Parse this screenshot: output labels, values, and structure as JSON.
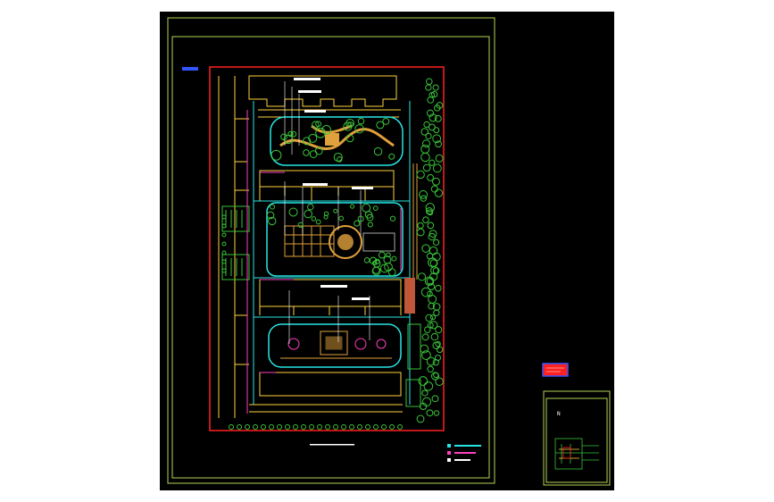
{
  "viewer": {
    "background": "#ffffff",
    "canvas_color": "#000000"
  },
  "drawing": {
    "frame_color": "#b4d455",
    "boundary_color": "#ff2020",
    "building_color": "#ffd23c",
    "road_color": "#27e6e6",
    "path_color": "#ff3fbf",
    "tree_color": "#39c43a",
    "paving_color": "#e0a13c",
    "label_color": "#ffffff",
    "tag_color": "#3355ff"
  },
  "legend": {
    "items": [
      {
        "swatch": "#27e6e6"
      },
      {
        "swatch": "#ff3fbf"
      },
      {
        "swatch": "#ffffff"
      }
    ]
  },
  "stamp": {
    "color": "#ff2020",
    "border": "#3355ff"
  },
  "keymap": {
    "label": "N"
  }
}
